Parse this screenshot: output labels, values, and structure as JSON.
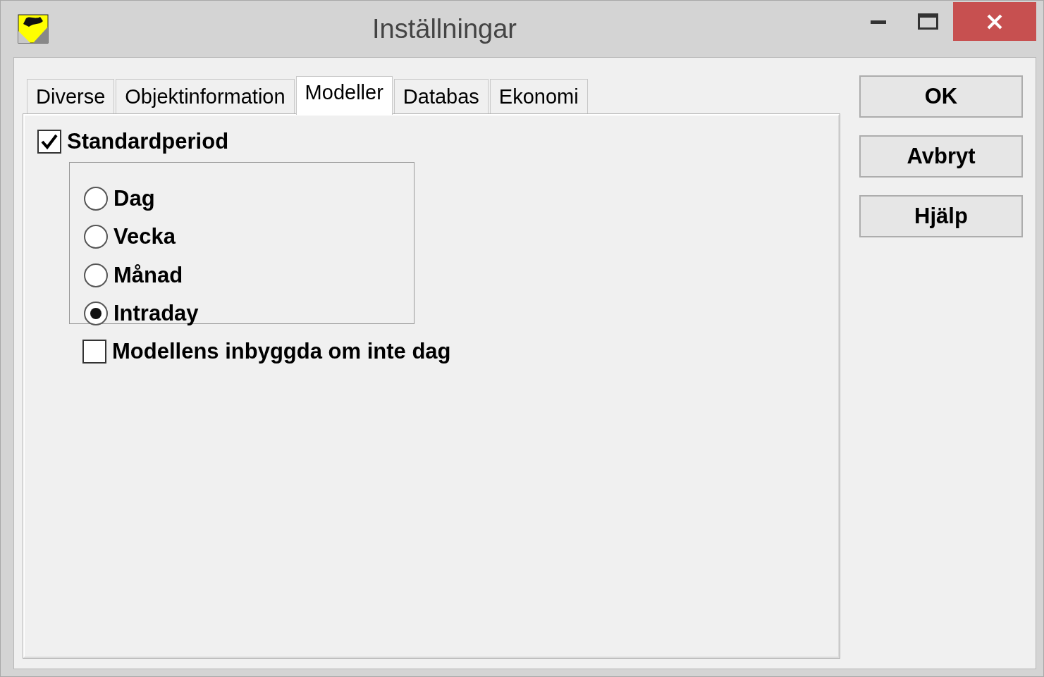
{
  "window": {
    "title": "Inställningar"
  },
  "tabs": [
    {
      "label": "Diverse",
      "selected": false
    },
    {
      "label": "Objektinformation",
      "selected": false
    },
    {
      "label": "Modeller",
      "selected": true
    },
    {
      "label": "Databas",
      "selected": false
    },
    {
      "label": "Ekonomi",
      "selected": false
    }
  ],
  "standard_period": {
    "label": "Standardperiod",
    "checked": true
  },
  "periods": [
    {
      "label": "Dag",
      "selected": false
    },
    {
      "label": "Vecka",
      "selected": false
    },
    {
      "label": "Månad",
      "selected": false
    },
    {
      "label": "Intraday",
      "selected": true
    }
  ],
  "model_builtin": {
    "label": "Modellens inbyggda om inte dag",
    "checked": false
  },
  "buttons": [
    "OK",
    "Avbryt",
    "Hjälp"
  ]
}
